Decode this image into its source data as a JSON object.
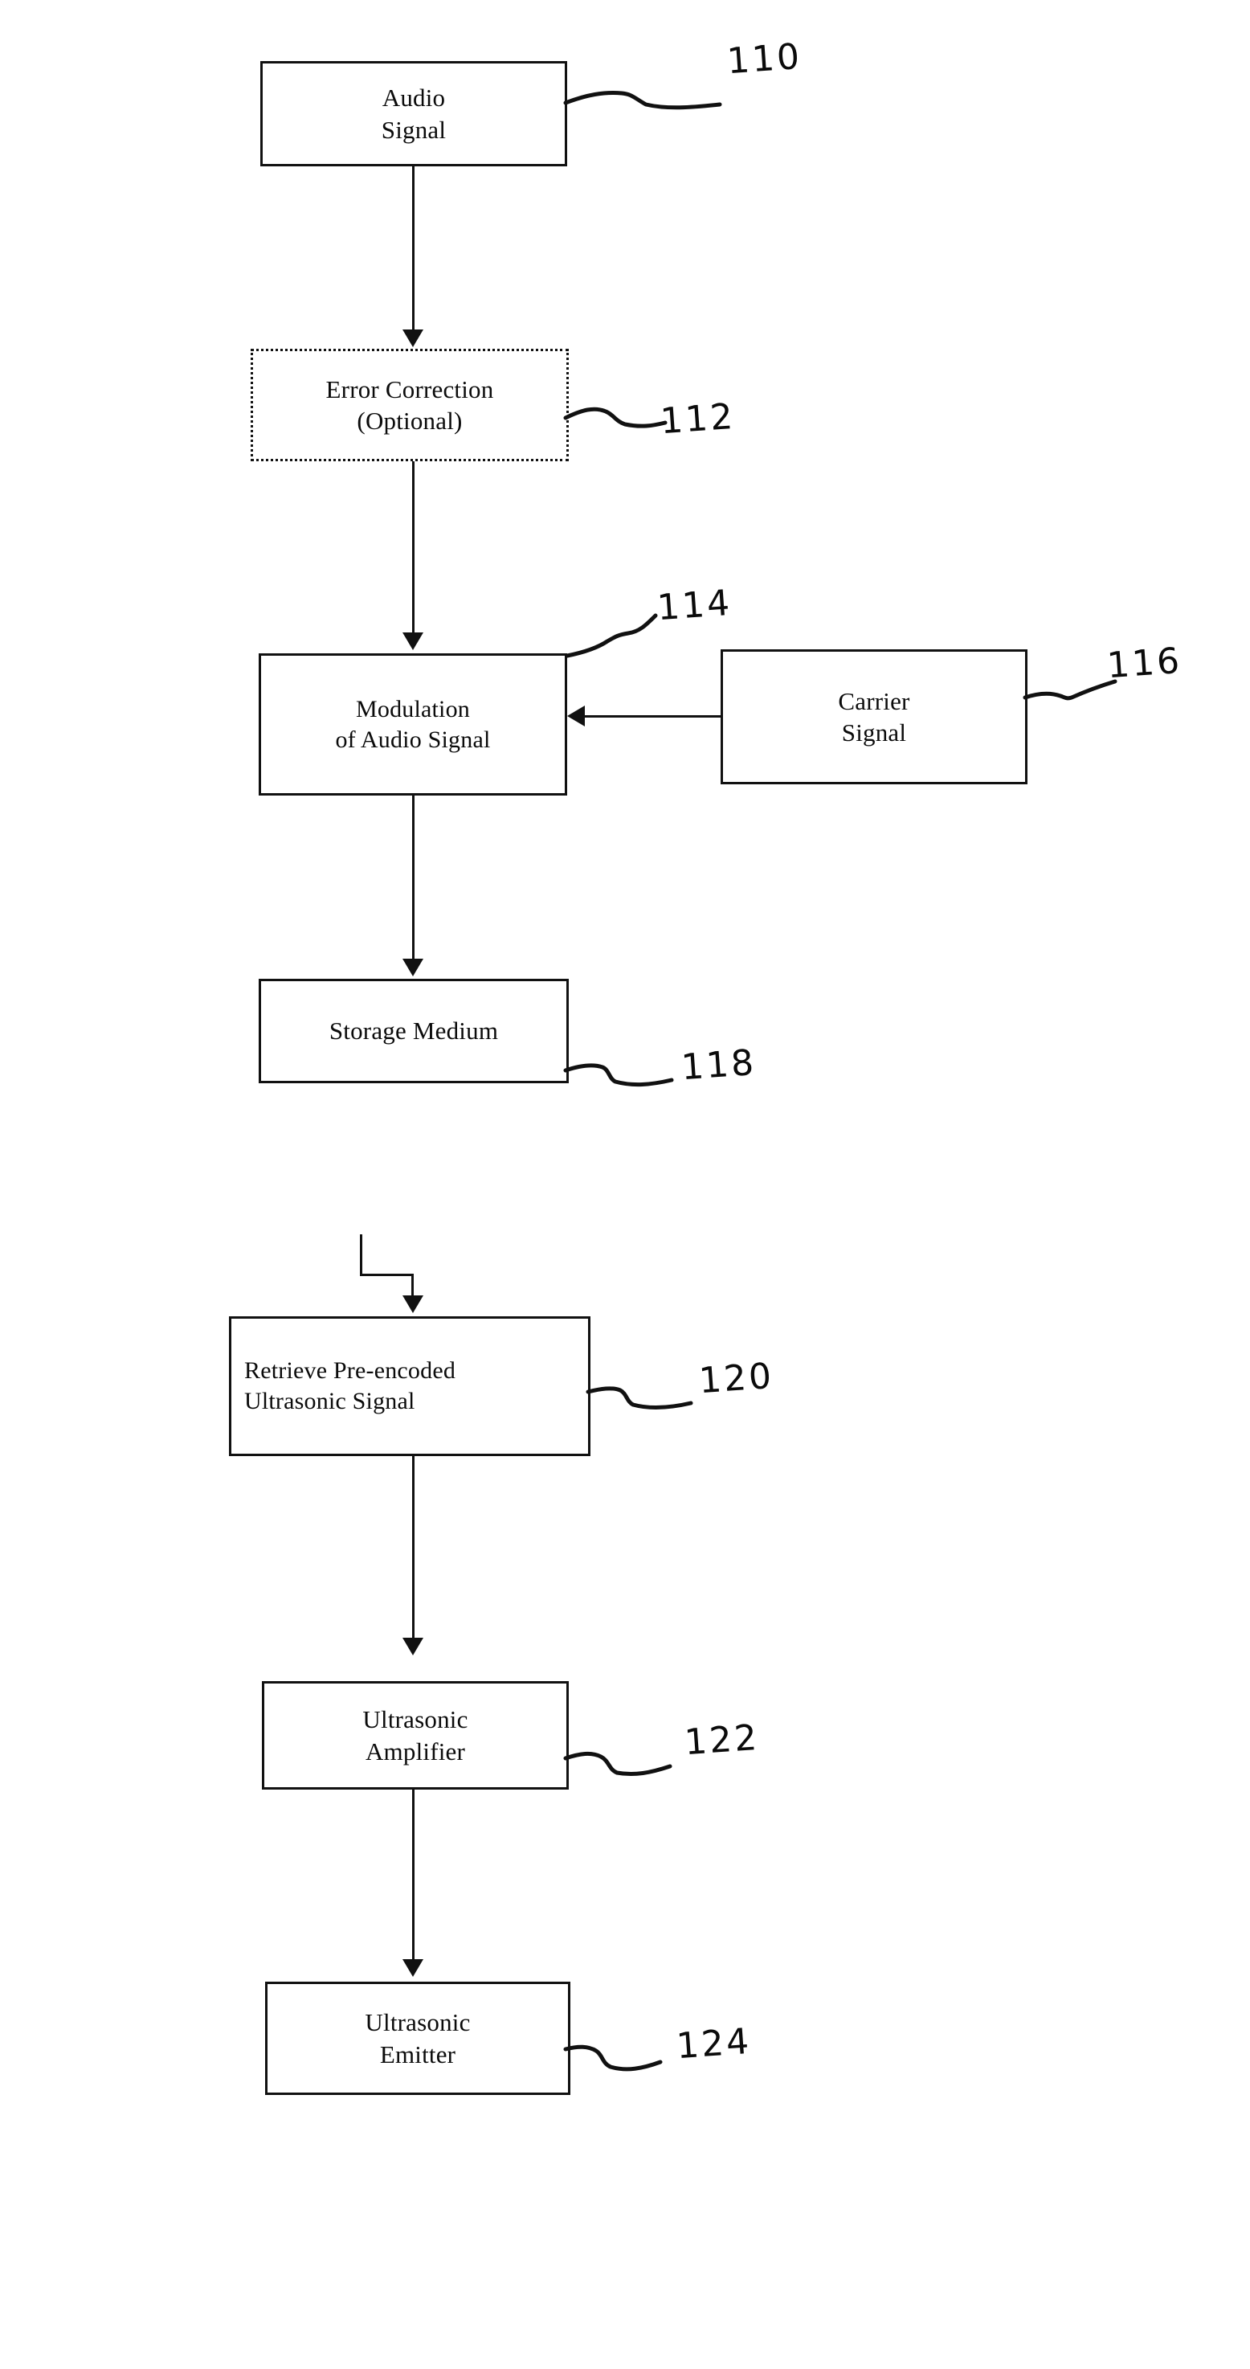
{
  "figure": {
    "type": "patent-flow-diagram",
    "background_color": "#ffffff",
    "ink_color": "#111111"
  },
  "blocks": [
    {
      "id": "audio-signal",
      "lines": [
        "Audio",
        "Signal"
      ],
      "ref": "110",
      "border": "solid",
      "align": "center"
    },
    {
      "id": "error-correction",
      "lines": [
        "Error Correction",
        "(Optional)"
      ],
      "ref": "112",
      "border": "dotted",
      "align": "center"
    },
    {
      "id": "modulation",
      "lines": [
        "Modulation",
        "of Audio Signal"
      ],
      "ref": "114",
      "border": "solid",
      "align": "center"
    },
    {
      "id": "carrier-signal",
      "lines": [
        "Carrier",
        "Signal"
      ],
      "ref": "116",
      "border": "solid",
      "align": "center"
    },
    {
      "id": "storage-medium",
      "lines": [
        "Storage Medium"
      ],
      "ref": "118",
      "border": "solid",
      "align": "center"
    },
    {
      "id": "retrieve-pre-encoded",
      "lines": [
        "Retrieve Pre-encoded",
        "Ultrasonic Signal"
      ],
      "ref": "120",
      "border": "solid",
      "align": "left"
    },
    {
      "id": "ultrasonic-amplifier",
      "lines": [
        "Ultrasonic",
        "Amplifier"
      ],
      "ref": "122",
      "border": "solid",
      "align": "center"
    },
    {
      "id": "ultrasonic-emitter",
      "lines": [
        "Ultrasonic",
        "Emitter"
      ],
      "ref": "124",
      "border": "solid",
      "align": "center"
    }
  ],
  "connections": [
    {
      "from": "audio-signal",
      "to": "error-correction",
      "kind": "arrow-down"
    },
    {
      "from": "error-correction",
      "to": "modulation",
      "kind": "arrow-down"
    },
    {
      "from": "carrier-signal",
      "to": "modulation",
      "kind": "arrow-left"
    },
    {
      "from": "modulation",
      "to": "storage-medium",
      "kind": "arrow-down"
    },
    {
      "from": "storage-medium",
      "to": "retrieve-pre-encoded",
      "kind": "arrow-down-stepped"
    },
    {
      "from": "retrieve-pre-encoded",
      "to": "ultrasonic-amplifier",
      "kind": "arrow-down"
    },
    {
      "from": "ultrasonic-amplifier",
      "to": "ultrasonic-emitter",
      "kind": "arrow-down"
    }
  ]
}
